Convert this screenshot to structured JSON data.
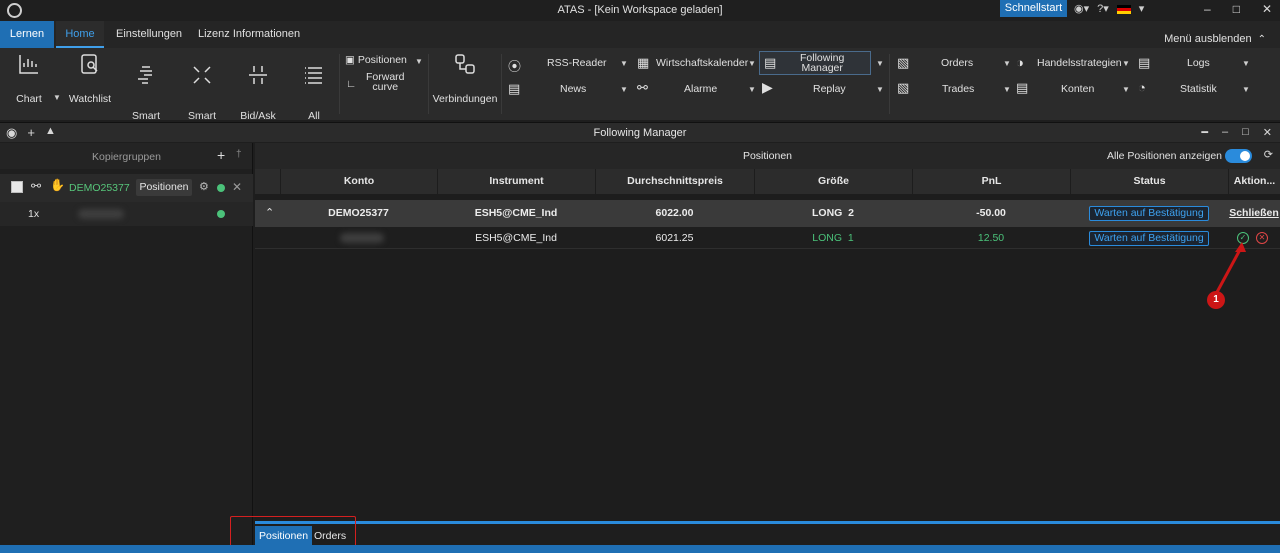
{
  "window": {
    "title": "ATAS - [Kein Workspace geladen]",
    "quickstart": "Schnellstart",
    "flag_colors": [
      "#000000",
      "#dd0000",
      "#ffce00"
    ]
  },
  "ribbon": {
    "tabs": [
      "Lernen",
      "Home",
      "Einstellungen",
      "Lizenz Informationen"
    ],
    "menu_hide": "Menü ausblenden",
    "big_buttons": {
      "chart": "Chart",
      "watchlist": "Watchlist",
      "smart_dom": "Smart\nDOM",
      "smart_tape": "Smart\nTape",
      "bid_ask_tape": "Bid/Ask\nTape",
      "all_prices": "All\nPrices",
      "verbindungen": "Verbindungen"
    },
    "small": {
      "positionen": "Positionen",
      "forward_curve": "Forward\ncurve",
      "rss": "RSS-Reader",
      "news": "News",
      "wirtschaftskalender": "Wirtschaftskalender",
      "alarme": "Alarme",
      "following_manager": "Following\nManager",
      "replay": "Replay",
      "orders": "Orders",
      "trades": "Trades",
      "handelsstrategien": "Handelsstrategien",
      "konten": "Konten",
      "logs": "Logs",
      "statistik": "Statistik"
    }
  },
  "following_manager": {
    "title": "Following Manager",
    "left": {
      "header": "Kopiergruppen",
      "group_name": "DEMO25377",
      "group_button": "Positionen",
      "multiplier": "1x",
      "status_color": "#4bc27a"
    },
    "main": {
      "title": "Positionen",
      "show_all_label": "Alle Positionen anzeigen",
      "show_all_on": true,
      "columns": [
        "Konto",
        "Instrument",
        "Durchschnittspreis",
        "Größe",
        "PnL",
        "Status",
        "Aktion..."
      ],
      "rows": [
        {
          "konto": "DEMO25377",
          "instrument": "ESH5@CME_Ind",
          "price": "6022.00",
          "size": "LONG  2",
          "pnl": "-50.00",
          "status": "Warten auf Bestätigung",
          "action": "Schließen"
        },
        {
          "konto": "",
          "instrument": "ESH5@CME_Ind",
          "price": "6021.25",
          "size": "LONG  1",
          "pnl": "12.50",
          "status": "Warten auf Bestätigung",
          "action": ""
        }
      ]
    },
    "bottom_tabs": [
      "Positionen",
      "Orders"
    ]
  },
  "annotation": {
    "label": "1"
  }
}
